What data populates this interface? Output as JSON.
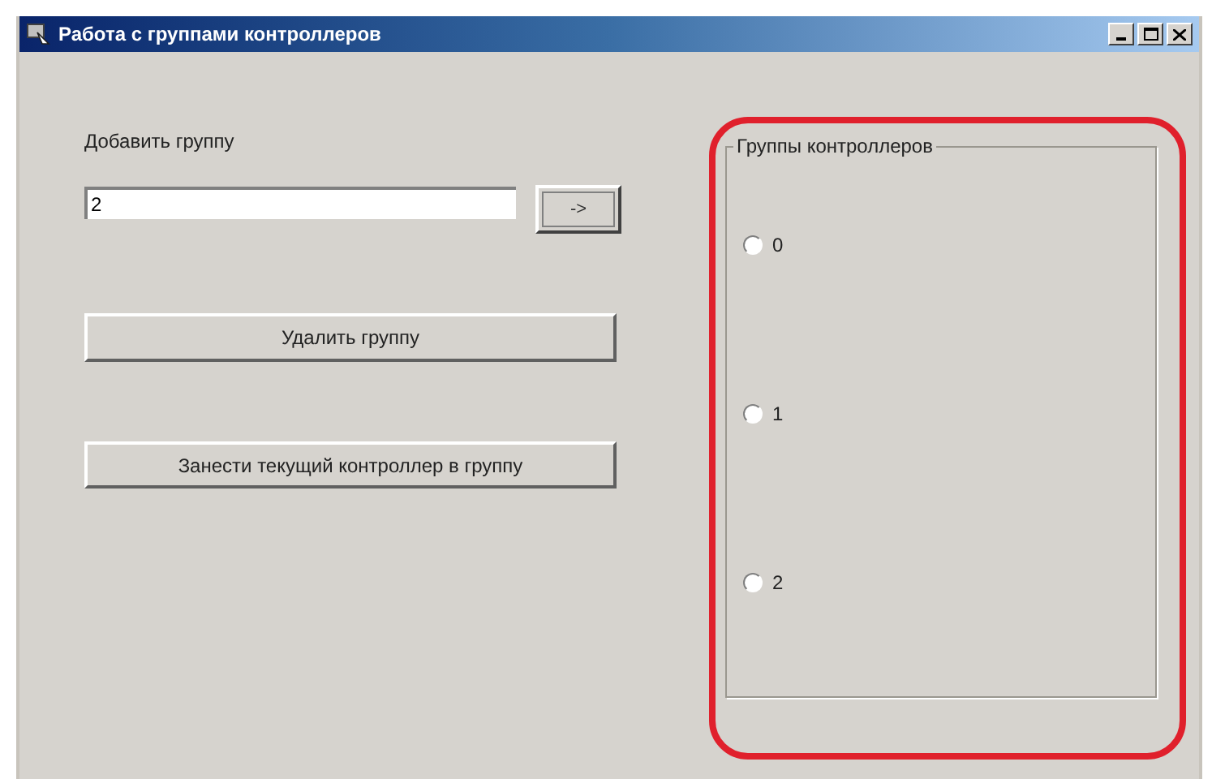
{
  "window": {
    "title": "Работа с группами контроллеров"
  },
  "add_group": {
    "label": "Добавить группу",
    "value": "2",
    "submit": "->"
  },
  "buttons": [
    "Удалить группу",
    "Занести текущий контроллер в группу"
  ],
  "group_box": {
    "title": "Группы контроллеров",
    "radios": [
      {
        "label": "0",
        "selected": false
      },
      {
        "label": "1",
        "selected": false
      },
      {
        "label": "2",
        "selected": false
      }
    ]
  },
  "highlight": {
    "color": "#e0202c"
  }
}
